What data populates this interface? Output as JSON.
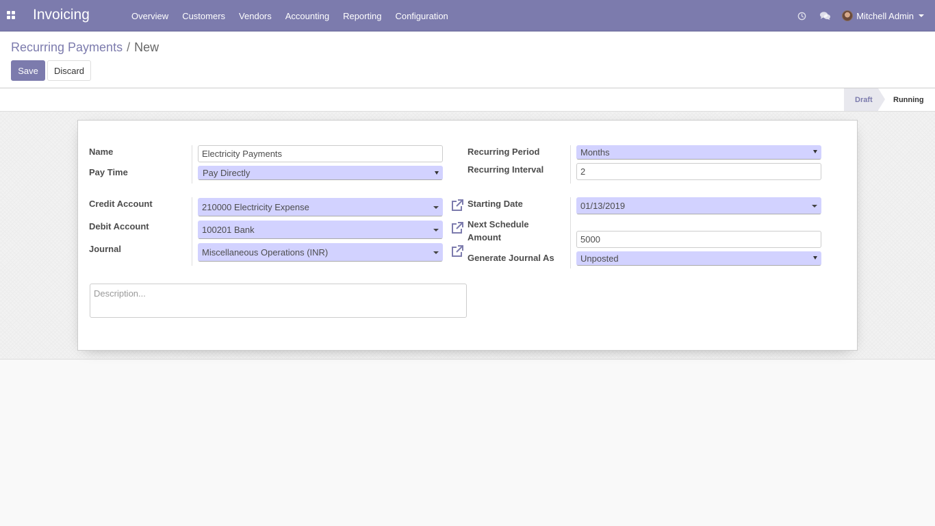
{
  "app": {
    "title": "Invoicing"
  },
  "menu": {
    "items": [
      "Overview",
      "Customers",
      "Vendors",
      "Accounting",
      "Reporting",
      "Configuration"
    ]
  },
  "systray": {
    "user_name": "Mitchell Admin"
  },
  "breadcrumb": {
    "parent": "Recurring Payments",
    "separator": "/",
    "current": "New"
  },
  "buttons": {
    "save": "Save",
    "discard": "Discard"
  },
  "statusbar": {
    "stages": [
      "Draft",
      "Running"
    ],
    "active": "Draft"
  },
  "form": {
    "name": {
      "label": "Name",
      "value": "Electricity Payments"
    },
    "pay_time": {
      "label": "Pay Time",
      "value": "Pay Directly"
    },
    "credit_account": {
      "label": "Credit Account",
      "value": "210000 Electricity Expense"
    },
    "debit_account": {
      "label": "Debit Account",
      "value": "100201 Bank"
    },
    "journal": {
      "label": "Journal",
      "value": "Miscellaneous Operations (INR)"
    },
    "recurring_period": {
      "label": "Recurring Period",
      "value": "Months"
    },
    "recurring_interval": {
      "label": "Recurring Interval",
      "value": "2"
    },
    "starting_date": {
      "label": "Starting Date",
      "value": "01/13/2019"
    },
    "next_schedule_line1": "Next Schedule",
    "amount": {
      "label": "Amount",
      "value": "5000"
    },
    "generate_journal_as": {
      "label": "Generate Journal As",
      "value": "Unposted"
    },
    "description": {
      "placeholder": "Description..."
    }
  },
  "colors": {
    "brand": "#7c7bad",
    "required_field": "#d2d2ff"
  },
  "icons": {
    "apps": "apps-grid-icon",
    "activity": "clock-icon",
    "discuss": "chat-bubbles-icon",
    "external": "external-link-icon"
  }
}
